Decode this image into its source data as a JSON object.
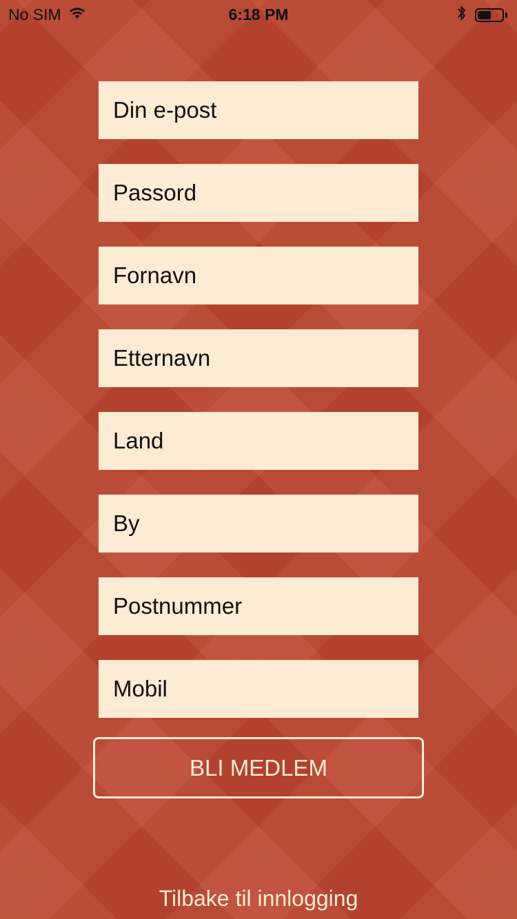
{
  "status_bar": {
    "carrier": "No SIM",
    "time": "6:18 PM",
    "icons": [
      "wifi-icon",
      "bluetooth-icon",
      "battery-icon"
    ],
    "battery_level": 0.55
  },
  "form": {
    "fields": [
      {
        "placeholder": "Din e-post",
        "value": ""
      },
      {
        "placeholder": "Passord",
        "value": ""
      },
      {
        "placeholder": "Fornavn",
        "value": ""
      },
      {
        "placeholder": "Etternavn",
        "value": ""
      },
      {
        "placeholder": "Land",
        "value": ""
      },
      {
        "placeholder": "By",
        "value": ""
      },
      {
        "placeholder": "Postnummer",
        "value": ""
      },
      {
        "placeholder": "Mobil",
        "value": ""
      }
    ],
    "submit_label": "BLI MEDLEM"
  },
  "footer": {
    "back_link": "Tilbake til innlogging"
  },
  "colors": {
    "background": "#bc4630",
    "field_background": "#fdebd3",
    "button_text": "#fdebd3"
  }
}
